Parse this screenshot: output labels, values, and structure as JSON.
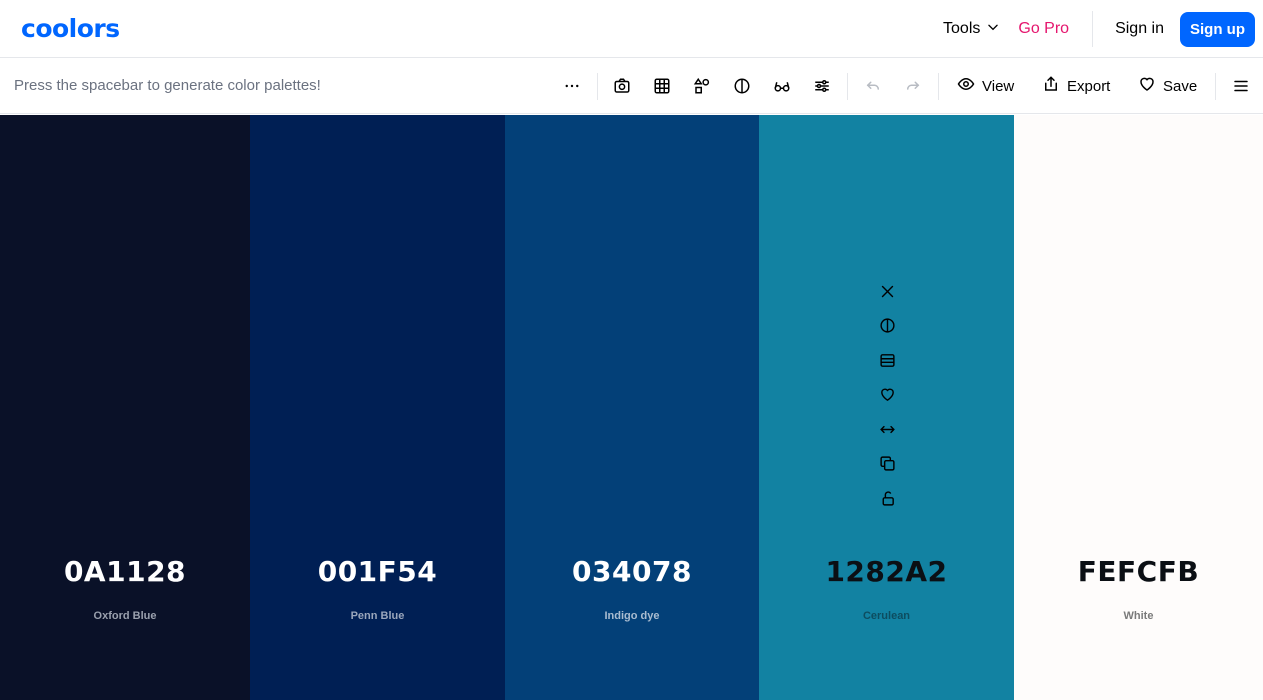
{
  "brand": {
    "logo": "coolors",
    "color": "#0066ff"
  },
  "nav": {
    "tools_label": "Tools",
    "gopro_label": "Go Pro",
    "signin_label": "Sign in",
    "signup_label": "Sign up"
  },
  "toolbar": {
    "hint": "Press the spacebar to generate color palettes!",
    "icons": [
      "more-icon",
      "camera-icon",
      "grid-icon",
      "shapes-icon",
      "contrast-icon",
      "glasses-icon",
      "sliders-icon",
      "undo-icon",
      "redo-icon"
    ],
    "view_label": "View",
    "export_label": "Export",
    "save_label": "Save"
  },
  "palette": [
    {
      "hex": "0A1128",
      "name": "Oxford Blue",
      "color": "#0A1128",
      "text_color": "#ffffff",
      "name_color": "#9aa0ad"
    },
    {
      "hex": "001F54",
      "name": "Penn Blue",
      "color": "#001F54",
      "text_color": "#ffffff",
      "name_color": "#9aa6bb"
    },
    {
      "hex": "034078",
      "name": "Indigo dye",
      "color": "#034078",
      "text_color": "#ffffff",
      "name_color": "#a9bcd0"
    },
    {
      "hex": "1282A2",
      "name": "Cerulean",
      "color": "#1282A2",
      "text_color": "#0b0f14",
      "name_color": "#0d4d60"
    },
    {
      "hex": "FEFCFB",
      "name": "White",
      "color": "#FEFCFB",
      "text_color": "#0b0f14",
      "name_color": "#7a7a7a"
    }
  ],
  "swatch_tools": [
    "close-icon",
    "contrast-icon",
    "shades-icon",
    "heart-icon",
    "drag-icon",
    "copy-icon",
    "lock-icon"
  ]
}
